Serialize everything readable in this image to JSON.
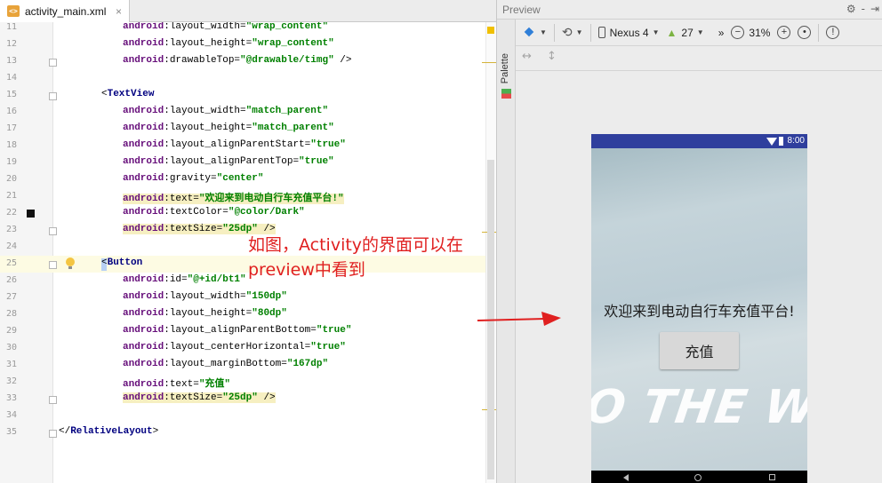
{
  "editor": {
    "tab_label": "activity_main.xml",
    "tab_close": "×",
    "file_badge": "<>",
    "lines": [
      {
        "num": "11",
        "parts": [
          [
            "ns",
            "android"
          ],
          [
            "brk",
            ":layout_width="
          ],
          [
            "val",
            "\"wrap_content\""
          ]
        ]
      },
      {
        "num": "12",
        "parts": [
          [
            "ns",
            "android"
          ],
          [
            "brk",
            ":layout_height="
          ],
          [
            "val",
            "\"wrap_content\""
          ]
        ]
      },
      {
        "num": "13",
        "parts": [
          [
            "ns",
            "android"
          ],
          [
            "brk",
            ":drawableTop="
          ],
          [
            "val",
            "\"@drawable/timg\""
          ],
          [
            "brk",
            " />"
          ]
        ]
      },
      {
        "num": "14",
        "parts": []
      },
      {
        "num": "15",
        "parts": [
          [
            "brk",
            "<"
          ],
          [
            "tag",
            "TextView"
          ]
        ]
      },
      {
        "num": "16",
        "parts": [
          [
            "ns",
            "android"
          ],
          [
            "brk",
            ":layout_width="
          ],
          [
            "val",
            "\"match_parent\""
          ]
        ]
      },
      {
        "num": "17",
        "parts": [
          [
            "ns",
            "android"
          ],
          [
            "brk",
            ":layout_height="
          ],
          [
            "val",
            "\"match_parent\""
          ]
        ]
      },
      {
        "num": "18",
        "parts": [
          [
            "ns",
            "android"
          ],
          [
            "brk",
            ":layout_alignParentStart="
          ],
          [
            "val",
            "\"true\""
          ]
        ]
      },
      {
        "num": "19",
        "parts": [
          [
            "ns",
            "android"
          ],
          [
            "brk",
            ":layout_alignParentTop="
          ],
          [
            "val",
            "\"true\""
          ]
        ]
      },
      {
        "num": "20",
        "parts": [
          [
            "ns",
            "android"
          ],
          [
            "brk",
            ":gravity="
          ],
          [
            "val",
            "\"center\""
          ]
        ]
      },
      {
        "num": "21",
        "parts": [
          [
            "ns",
            "android"
          ],
          [
            "brk",
            ":text="
          ],
          [
            "val",
            "\"欢迎来到电动自行车充值平台!\""
          ]
        ],
        "marked": true
      },
      {
        "num": "22",
        "parts": [
          [
            "ns",
            "android"
          ],
          [
            "brk",
            ":textColor="
          ],
          [
            "val",
            "\"@color/Dark\""
          ]
        ]
      },
      {
        "num": "23",
        "parts": [
          [
            "ns",
            "android"
          ],
          [
            "brk",
            ":textSize="
          ],
          [
            "val",
            "\"25dp\""
          ],
          [
            "brk",
            " />"
          ]
        ],
        "marked": true
      },
      {
        "num": "24",
        "parts": []
      },
      {
        "num": "25",
        "parts": [
          [
            "brk",
            "<"
          ],
          [
            "tag",
            "Button"
          ]
        ]
      },
      {
        "num": "26",
        "parts": [
          [
            "ns",
            "android"
          ],
          [
            "brk",
            ":id="
          ],
          [
            "val",
            "\"@+id/bt1\""
          ]
        ]
      },
      {
        "num": "27",
        "parts": [
          [
            "ns",
            "android"
          ],
          [
            "brk",
            ":layout_width="
          ],
          [
            "val",
            "\"150dp\""
          ]
        ]
      },
      {
        "num": "28",
        "parts": [
          [
            "ns",
            "android"
          ],
          [
            "brk",
            ":layout_height="
          ],
          [
            "val",
            "\"80dp\""
          ]
        ]
      },
      {
        "num": "29",
        "parts": [
          [
            "ns",
            "android"
          ],
          [
            "brk",
            ":layout_alignParentBottom="
          ],
          [
            "val",
            "\"true\""
          ]
        ]
      },
      {
        "num": "30",
        "parts": [
          [
            "ns",
            "android"
          ],
          [
            "brk",
            ":layout_centerHorizontal="
          ],
          [
            "val",
            "\"true\""
          ]
        ]
      },
      {
        "num": "31",
        "parts": [
          [
            "ns",
            "android"
          ],
          [
            "brk",
            ":layout_marginBottom="
          ],
          [
            "val",
            "\"167dp\""
          ]
        ]
      },
      {
        "num": "32",
        "parts": [
          [
            "ns",
            "android"
          ],
          [
            "brk",
            ":text="
          ],
          [
            "val",
            "\"充值\""
          ]
        ]
      },
      {
        "num": "33",
        "parts": [
          [
            "ns",
            "android"
          ],
          [
            "brk",
            ":textSize="
          ],
          [
            "val",
            "\"25dp\""
          ],
          [
            "brk",
            " />"
          ]
        ],
        "marked": true
      },
      {
        "num": "34",
        "parts": []
      },
      {
        "num": "35",
        "parts": [
          [
            "brk",
            "</"
          ],
          [
            "tag",
            "RelativeLayout"
          ],
          [
            "brk",
            ">"
          ]
        ]
      }
    ]
  },
  "preview": {
    "title": "Preview",
    "header_icons": [
      "⚙",
      "-",
      "⇥"
    ],
    "palette_label": "Palette",
    "device_name": "Nexus 4",
    "api_level": "27",
    "zoom": "31%",
    "zoom_out": "−",
    "zoom_in": "+",
    "more": "»",
    "error_indicator": "!",
    "row2_icons": [
      "↔",
      "↕"
    ],
    "status_time": "8:00",
    "screen_text": "欢迎来到电动自行车充值平台!",
    "button_text": "充值",
    "background_art_text": "O THE W"
  },
  "annotation": {
    "line1": "如图，Activity的界面可以在",
    "line2": "preview中看到",
    "color": "#e02020"
  }
}
